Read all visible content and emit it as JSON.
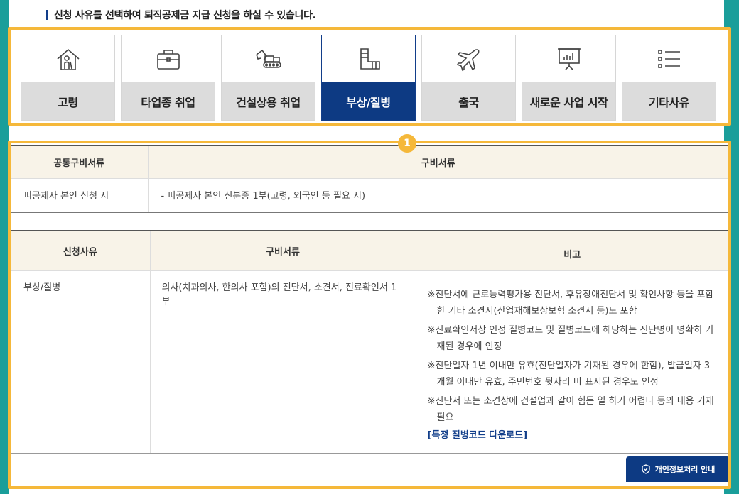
{
  "notice": "신청 사유를 선택하여 퇴직공제금 지급 신청을 하실 수 있습니다.",
  "tabs": [
    {
      "label": "고령",
      "icon": "elderly-house-icon",
      "active": false
    },
    {
      "label": "타업종 취업",
      "icon": "briefcase-icon",
      "active": false
    },
    {
      "label": "건설상용 취업",
      "icon": "excavator-icon",
      "active": false
    },
    {
      "label": "부상/질병",
      "icon": "cast-injury-icon",
      "active": true
    },
    {
      "label": "출국",
      "icon": "airplane-icon",
      "active": false
    },
    {
      "label": "새로운 사업 시작",
      "icon": "presentation-board-icon",
      "active": false
    },
    {
      "label": "기타사유",
      "icon": "list-icon",
      "active": false
    }
  ],
  "badge": "1",
  "common_table": {
    "headers": [
      "공통구비서류",
      "구비서류"
    ],
    "rows": [
      [
        "피공제자 본인 신청 시",
        "- 피공제자 본인 신분증 1부(고령, 외국인 등 필요 시)"
      ]
    ]
  },
  "reason_table": {
    "headers": [
      "신청사유",
      "구비서류",
      "비고"
    ],
    "reason": "부상/질병",
    "documents": "의사(치과의사, 한의사 포함)의 진단서, 소견서, 진료확인서 1부",
    "notes": [
      "※진단서에 근로능력평가용 진단서, 후유장애진단서 및 확인사항 등을 포함한 기타 소견서(산업재해보상보험 소견서 등)도 포함",
      "※진료확인서상 인정 질병코드 및 질병코드에 해당하는 진단명이 명확히 기재된 경우에 인정",
      "※진단일자 1년 이내만 유효(진단일자가 기재된 경우에 한함), 발급일자 3개월 이내만 유효, 주민번호 뒷자리 미 표시된 경우도 인정",
      "※진단서 또는 소견상에 건설업과 같이 힘든 일 하기 어렵다 등의 내용 기재 필요"
    ],
    "download_link": "[특정 질병코드 다운로드]"
  },
  "privacy_button": "개인정보처리 안내",
  "colors": {
    "accent": "#f5b83a",
    "active_tab": "#0d3a83",
    "background": "#1a9e9a"
  }
}
